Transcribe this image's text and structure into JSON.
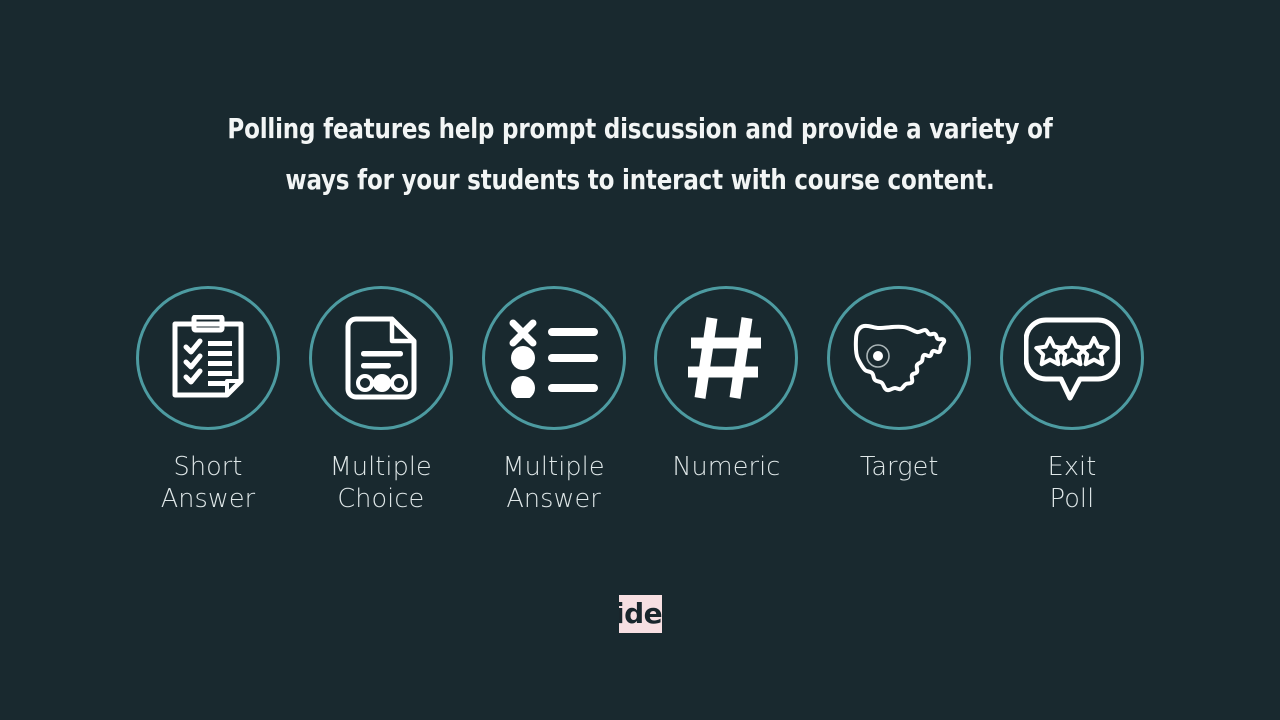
{
  "slide": {
    "background_color": "#19292f",
    "accent_color": "#4d9ba1",
    "icon_color": "#ffffff",
    "headline_color": "#f2f5f5",
    "label_color": "#dfe7e8"
  },
  "headline": {
    "line1": "Polling features help prompt discussion and provide a variety of",
    "line2": "ways for your students to interact with course content."
  },
  "poll_types": [
    {
      "label": "Short\nAnswer",
      "label_line1": "Short",
      "label_line2": "Answer",
      "icon": "clipboard-checklist-icon"
    },
    {
      "label": "Multiple\nChoice",
      "label_line1": "Multiple",
      "label_line2": "Choice",
      "icon": "document-options-icon"
    },
    {
      "label": "Multiple\nAnswer",
      "label_line1": "Multiple",
      "label_line2": "Answer",
      "icon": "checklist-x-bullets-icon"
    },
    {
      "label": "Numeric",
      "label_line1": "Numeric",
      "label_line2": "",
      "icon": "hash-icon"
    },
    {
      "label": "Target",
      "label_line1": "Target",
      "label_line2": "",
      "icon": "us-map-target-icon"
    },
    {
      "label": "Exit\nPoll",
      "label_line1": "Exit",
      "label_line2": "Poll",
      "icon": "speech-bubble-stars-icon"
    }
  ],
  "logo": {
    "text": "ide",
    "background_color": "#f7dfe2",
    "text_color": "#19262c"
  }
}
